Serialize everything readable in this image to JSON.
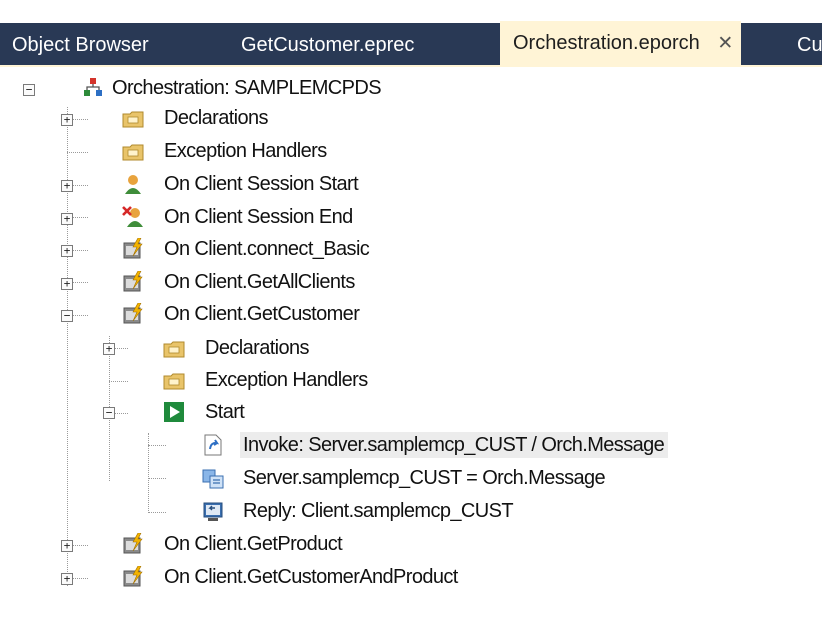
{
  "tabs": [
    {
      "label": "Object Browser",
      "active": false
    },
    {
      "label": "GetCustomer.eprec",
      "active": false
    },
    {
      "label": "Orchestration.eporch",
      "active": true,
      "close": "✕"
    },
    {
      "label": "Cu",
      "active": false
    }
  ],
  "tree": {
    "root": {
      "label": "Orchestration: SAMPLEMCPDS",
      "icon": "orchestration-icon",
      "expander": "−"
    },
    "items": [
      {
        "label": "Declarations",
        "icon": "folder-icon",
        "expander": "+"
      },
      {
        "label": "Exception Handlers",
        "icon": "folder-icon",
        "expander": ""
      },
      {
        "label": "On Client Session Start",
        "icon": "user-start-icon",
        "expander": "+"
      },
      {
        "label": "On Client Session End",
        "icon": "user-end-icon",
        "expander": "+"
      },
      {
        "label": "On Client.connect_Basic",
        "icon": "event-icon",
        "expander": "+"
      },
      {
        "label": "On Client.GetAllClients",
        "icon": "event-icon",
        "expander": "+"
      },
      {
        "label": "On Client.GetCustomer",
        "icon": "event-icon",
        "expander": "−"
      },
      {
        "label": "Declarations",
        "icon": "folder-icon",
        "expander": "+"
      },
      {
        "label": "Exception Handlers",
        "icon": "folder-icon",
        "expander": ""
      },
      {
        "label": "Start",
        "icon": "start-icon",
        "expander": "−"
      },
      {
        "label": "Invoke: Server.samplemcp_CUST / Orch.Message",
        "icon": "invoke-icon",
        "expander": "",
        "selected": true
      },
      {
        "label": "Server.samplemcp_CUST = Orch.Message",
        "icon": "assign-icon",
        "expander": ""
      },
      {
        "label": "Reply: Client.samplemcp_CUST",
        "icon": "reply-icon",
        "expander": ""
      },
      {
        "label": "On Client.GetProduct",
        "icon": "event-icon",
        "expander": "+"
      },
      {
        "label": "On Client.GetCustomerAndProduct",
        "icon": "event-icon",
        "expander": "+"
      }
    ]
  }
}
